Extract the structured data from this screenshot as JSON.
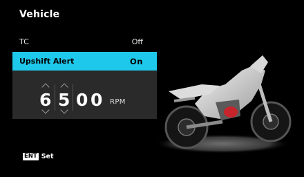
{
  "header": {
    "title": "Vehicle"
  },
  "menu": {
    "items": [
      {
        "label": "TC",
        "value": "Off"
      },
      {
        "label": "Upshift Alert",
        "value": "On"
      }
    ]
  },
  "rpm_editor": {
    "digits": [
      "6",
      "5",
      "0",
      "0"
    ],
    "unit": "RPM"
  },
  "footer": {
    "key_badge": "ENT",
    "action": "Set"
  },
  "colors": {
    "highlight": "#1ec8ea",
    "editor_background": "#2a2a2a",
    "background": "#000000"
  },
  "icons": [
    "chevron-up-icon",
    "chevron-down-icon",
    "motorcycle-image"
  ]
}
